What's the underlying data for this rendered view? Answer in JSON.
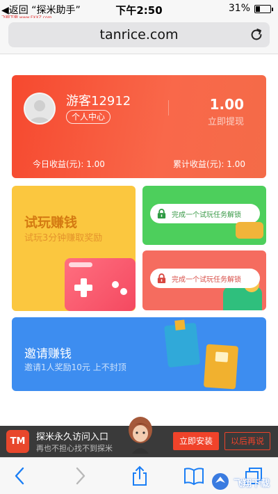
{
  "status_bar": {
    "back_label": "◀返回 “探米助手”",
    "time": "下午2:50",
    "battery_percent": "31%",
    "battery_level": 0.31,
    "watermark": "飞翔下载 www.FXXZ.com"
  },
  "browser": {
    "url": "tanrice.com"
  },
  "profile": {
    "username": "游客12912",
    "center_label": "个人中心",
    "withdraw_amount": "1.00",
    "withdraw_label": "立即提现",
    "today_income": "今日收益(元):    1.00",
    "total_income": "累计收益(元):    1.00"
  },
  "tiles": {
    "trial": {
      "title": "试玩赚钱",
      "subtitle": "试玩3分钟赚取奖励"
    },
    "locked_1": {
      "text": "完成一个试玩任务解锁"
    },
    "locked_2": {
      "text": "完成一个试玩任务解锁"
    },
    "invite": {
      "title": "邀请赚钱",
      "subtitle": "邀请1人奖励10元 上不封顶"
    }
  },
  "app_banner": {
    "logo_text": "TM",
    "title": "探米永久访问入口",
    "subtitle": "再也不担心找不到探米",
    "install_label": "立即安装",
    "later_label": "以后再说"
  },
  "watermark_bottom": "飞翔下载",
  "colors": {
    "profile_card": "#f6492f",
    "trial_tile": "#fbc73f",
    "green_tile": "#4dcf5c",
    "red_tile": "#f56c5f",
    "invite_tile": "#3d8df0",
    "accent": "#f0432a",
    "ios_blue": "#1a7ef5"
  },
  "icons": {
    "back": "chevron-left-icon",
    "forward": "chevron-right-icon",
    "share": "share-icon",
    "bookmarks": "book-icon",
    "tabs": "tabs-icon",
    "reload": "reload-icon",
    "lock": "lock-icon"
  }
}
